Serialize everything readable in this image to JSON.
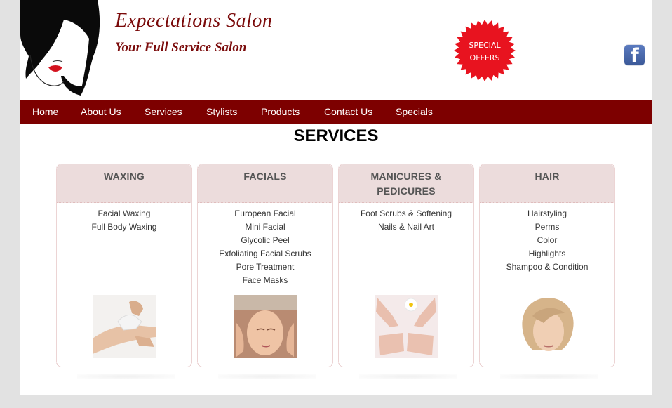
{
  "header": {
    "title": "Expectations Salon",
    "tagline": "Your Full Service Salon",
    "special_offers": [
      "SPECIAL",
      "OFFERS"
    ],
    "facebook_icon": "facebook-icon",
    "colors": {
      "brand": "#7d0000",
      "starburst": "#e8131f"
    }
  },
  "nav": {
    "items": [
      "Home",
      "About Us",
      "Services",
      "Stylists",
      "Products",
      "Contact Us",
      "Specials"
    ]
  },
  "page": {
    "heading": "SERVICES"
  },
  "services": [
    {
      "title": [
        "WAXING",
        ""
      ],
      "items": [
        "Facial Waxing",
        "Full Body Waxing",
        "",
        "",
        "",
        ""
      ]
    },
    {
      "title": [
        "FACIALS",
        ""
      ],
      "items": [
        "European Facial",
        "Mini Facial",
        "Glycolic Peel",
        "Exfoliating Facial Scrubs",
        "Pore Treatment",
        "Face Masks"
      ]
    },
    {
      "title": [
        "MANICURES &",
        "PEDICURES"
      ],
      "items": [
        "Foot Scrubs & Softening",
        "Nails & Nail Art",
        "",
        "",
        "",
        ""
      ]
    },
    {
      "title": [
        "HAIR",
        ""
      ],
      "items": [
        "Hairstyling",
        "Perms",
        "Color",
        "Highlights",
        "Shampoo & Condition",
        ""
      ]
    }
  ]
}
